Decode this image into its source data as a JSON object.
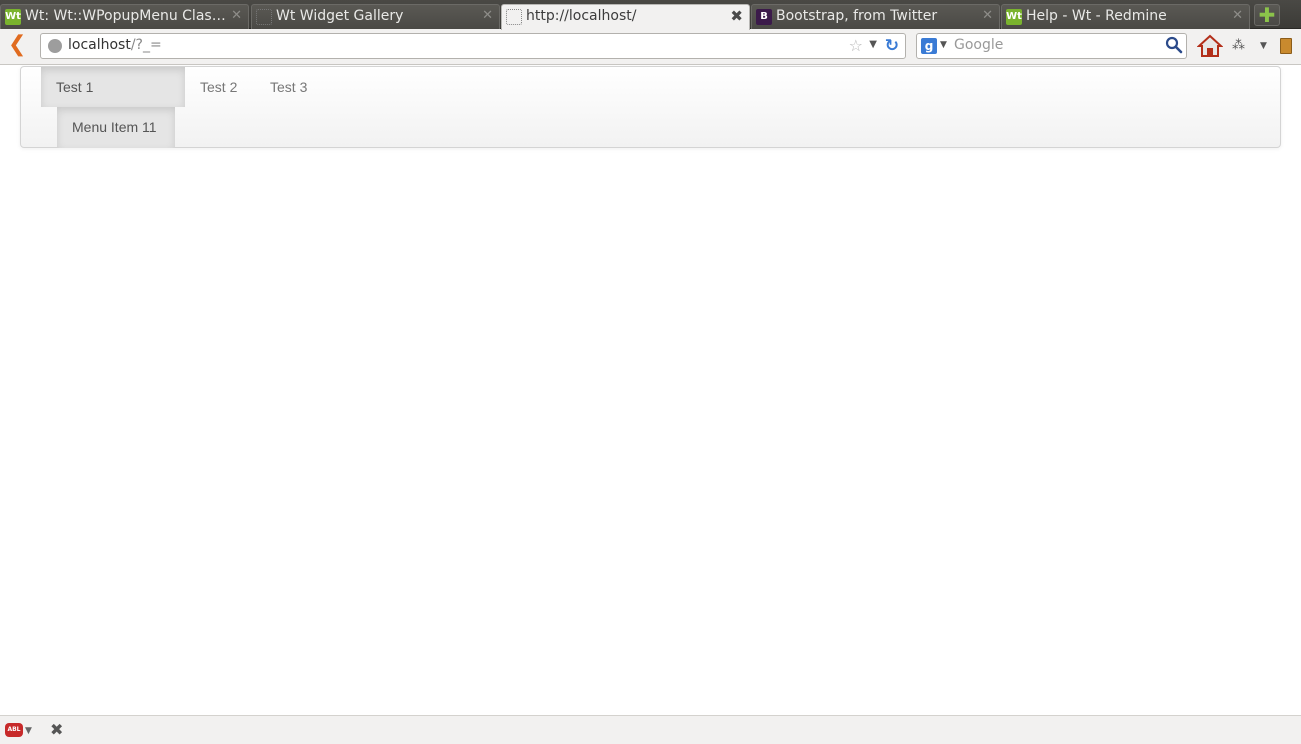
{
  "browser": {
    "tabs": [
      {
        "title": "Wt: Wt::WPopupMenu Clas…",
        "favicon": "Wt",
        "active": false
      },
      {
        "title": "Wt Widget Gallery",
        "favicon": "",
        "active": false
      },
      {
        "title": "http://localhost/",
        "favicon": "",
        "active": true
      },
      {
        "title": "Bootstrap, from Twitter",
        "favicon": "B",
        "active": false
      },
      {
        "title": "Help - Wt - Redmine",
        "favicon": "Wt",
        "active": false
      }
    ],
    "tab_close_glyph": "✕",
    "active_tab_close_glyph": "✖",
    "new_tab_glyph": "✚",
    "url": {
      "host": "localhost",
      "path": "/?_="
    },
    "search": {
      "placeholder": "Google",
      "engine_glyph": "g"
    },
    "addon_glyph": "⁂"
  },
  "page": {
    "menu": {
      "items": [
        {
          "label": "Test 1",
          "active": true
        },
        {
          "label": "Test 2",
          "active": false
        },
        {
          "label": "Test 3",
          "active": false
        }
      ],
      "submenu": {
        "label": "Menu Item 11"
      }
    }
  },
  "statusbar": {
    "adblock_label": "ABL",
    "close_glyph": "✖"
  },
  "colors": {
    "tabstrip": "#3c3b37",
    "active_item_bg": "#e5e5e5",
    "nav_text": "#777777",
    "back_arrow": "#e06b1f",
    "reload": "#3a7bd5"
  }
}
